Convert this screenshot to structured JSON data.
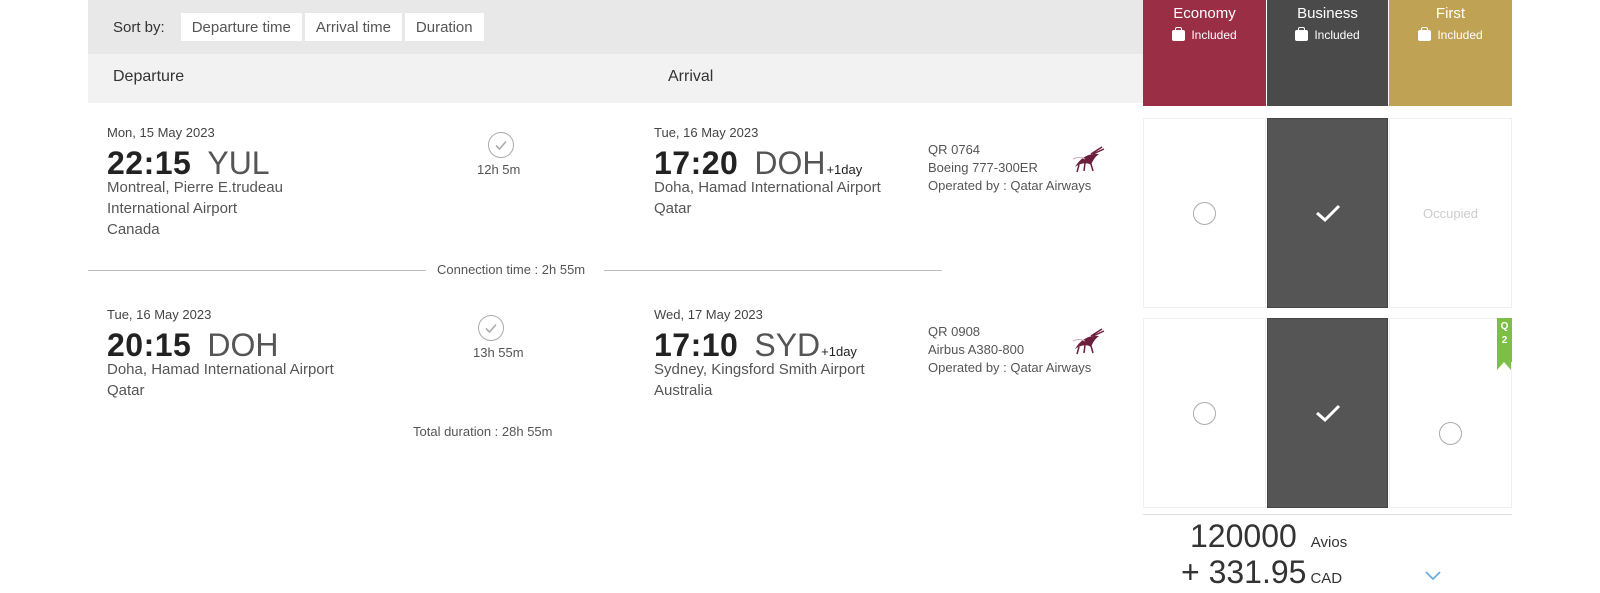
{
  "sort": {
    "label": "Sort by:",
    "options": [
      "Departure time",
      "Arrival time",
      "Duration"
    ]
  },
  "columns": {
    "departure": "Departure",
    "arrival": "Arrival"
  },
  "segments": [
    {
      "departure": {
        "date": "Mon, 15 May 2023",
        "time": "22:15",
        "code": "YUL",
        "place_lines": [
          "Montreal, Pierre E.trudeau",
          "International Airport",
          "Canada"
        ]
      },
      "duration": "12h 5m",
      "arrival": {
        "date": "Tue, 16 May 2023",
        "time": "17:20",
        "code": "DOH",
        "plus_day": "+1day",
        "place_lines": [
          "Doha, Hamad International Airport",
          "Qatar"
        ]
      },
      "flight": {
        "number": "QR 0764",
        "aircraft": "Boeing 777-300ER",
        "operated_by": "Operated by : Qatar Airways"
      }
    },
    {
      "departure": {
        "date": "Tue, 16 May 2023",
        "time": "20:15",
        "code": "DOH",
        "place_lines": [
          "Doha, Hamad International Airport",
          "Qatar"
        ]
      },
      "duration": "13h 55m",
      "arrival": {
        "date": "Wed, 17 May 2023",
        "time": "17:10",
        "code": "SYD",
        "plus_day": "+1day",
        "place_lines": [
          "Sydney, Kingsford Smith Airport",
          "Australia"
        ]
      },
      "flight": {
        "number": "QR 0908",
        "aircraft": "Airbus A380-800",
        "operated_by": "Operated by : Qatar Airways"
      }
    }
  ],
  "connection_time": "Connection time : 2h 55m",
  "total_duration": "Total duration : 28h 55m",
  "fares": [
    {
      "name": "Economy",
      "included": "Included",
      "color": "#9a2e44"
    },
    {
      "name": "Business",
      "included": "Included",
      "color": "#4a4a4a"
    },
    {
      "name": "First",
      "included": "Included",
      "color": "#bfa253"
    }
  ],
  "seat_status": {
    "occupied": "Occupied"
  },
  "selected_fare": "Business",
  "side_tag": {
    "text1": "Q",
    "text2": "2",
    "color": "#7dbf46"
  },
  "price": {
    "avios": "120000",
    "avios_unit": "Avios",
    "cash": "+ 331.95",
    "currency": "CAD"
  },
  "icons": {
    "duration": "check-circle-icon",
    "airline": "qatar-airways-oryx-logo",
    "baggage": "suitcase-icon",
    "selected": "checkmark-icon",
    "expand": "chevron-down-icon"
  }
}
